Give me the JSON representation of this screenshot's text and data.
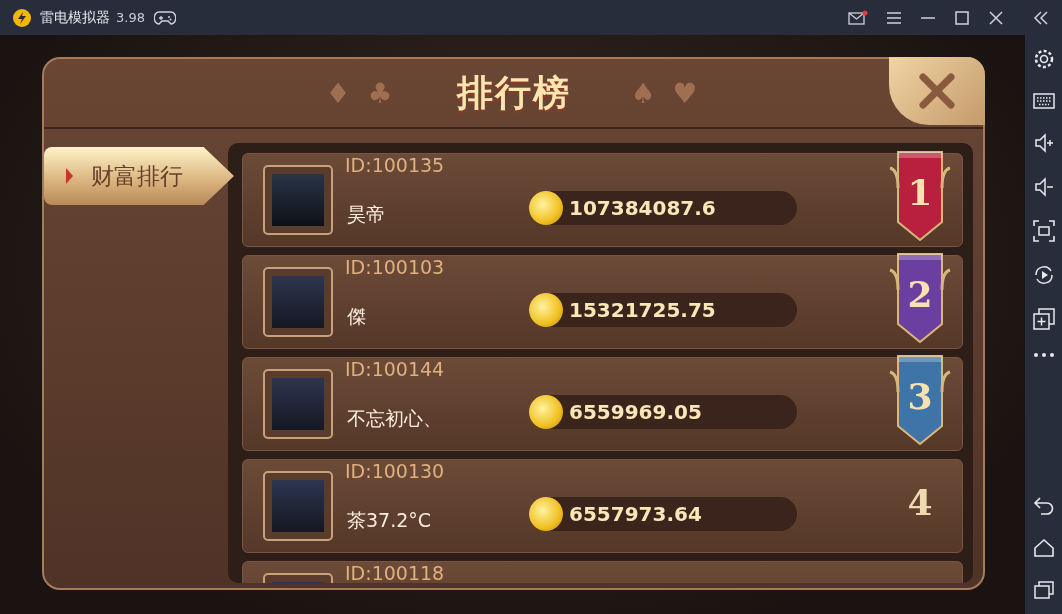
{
  "window": {
    "title": "雷电模拟器",
    "version": "3.98"
  },
  "dialog": {
    "title": "排行榜",
    "suits_left": [
      "♦",
      "♣"
    ],
    "suits_right": [
      "♠",
      "♥"
    ]
  },
  "tabs": [
    {
      "label": "财富排行",
      "selected": true
    }
  ],
  "rows": [
    {
      "id": "ID:100135",
      "name": "昊帝",
      "amount": "107384087.6",
      "rank": "1",
      "kind": "ribbon",
      "color": "#b8203e"
    },
    {
      "id": "ID:100103",
      "name": "傑",
      "amount": "15321725.75",
      "rank": "2",
      "kind": "ribbon",
      "color": "#6b3fa0"
    },
    {
      "id": "ID:100144",
      "name": "不忘初心、",
      "amount": "6559969.05",
      "rank": "3",
      "kind": "ribbon",
      "color": "#3f74a8"
    },
    {
      "id": "ID:100130",
      "name": "茶37.2°C",
      "amount": "6557973.64",
      "rank": "4",
      "kind": "plain"
    },
    {
      "id": "ID:100118",
      "kind": "partial"
    }
  ]
}
